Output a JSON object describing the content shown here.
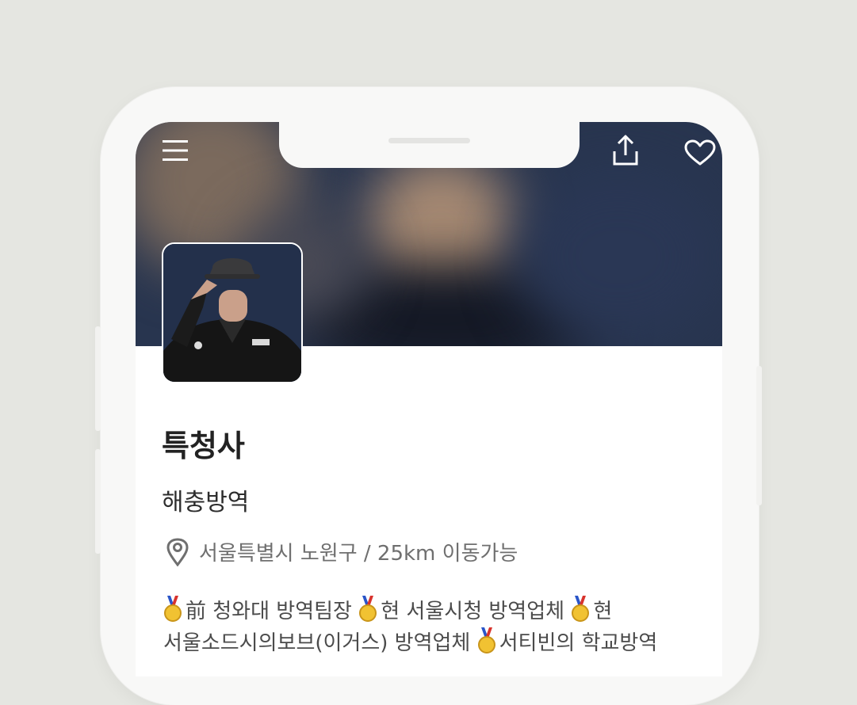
{
  "profile": {
    "name": "특청사",
    "category": "해충방역",
    "location": "서울특별시 노원구 / 25km 이동가능",
    "bio": [
      {
        "text": "前 청와대 방역팀장"
      },
      {
        "text": "현 서울시청 방역업체"
      },
      {
        "text": "현 서울소드시의보브(이거스) 방역업체"
      },
      {
        "text": "서티빈의 학교방역"
      }
    ]
  },
  "header": {
    "menu_icon": "menu-icon",
    "share_icon": "share-icon",
    "heart_icon": "heart-icon"
  },
  "colors": {
    "background": "#e5e6e1",
    "cover": "#28354f",
    "name": "#222222",
    "location": "#6f6f6f"
  }
}
